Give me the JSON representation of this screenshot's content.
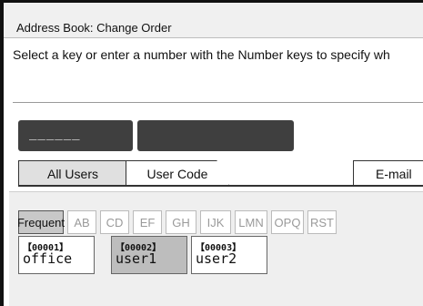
{
  "window": {
    "title": "Address Book: Change Order"
  },
  "instruction": "Select a key or enter a number with the Number keys to specify wh",
  "input": {
    "number_display": "______",
    "second_display": ""
  },
  "tabs": [
    {
      "label": "All Users"
    },
    {
      "label": "User Code"
    },
    {
      "label": "E-mail"
    }
  ],
  "index_keys": [
    {
      "label": "Frequent"
    },
    {
      "label": "AB"
    },
    {
      "label": "CD"
    },
    {
      "label": "EF"
    },
    {
      "label": "GH"
    },
    {
      "label": "IJK"
    },
    {
      "label": "LMN"
    },
    {
      "label": "OPQ"
    },
    {
      "label": "RST"
    }
  ],
  "entries": [
    {
      "code": "【00001】",
      "name": "office"
    },
    {
      "code": "【00002】",
      "name": "user1"
    },
    {
      "code": "【00003】",
      "name": "user2"
    }
  ]
}
